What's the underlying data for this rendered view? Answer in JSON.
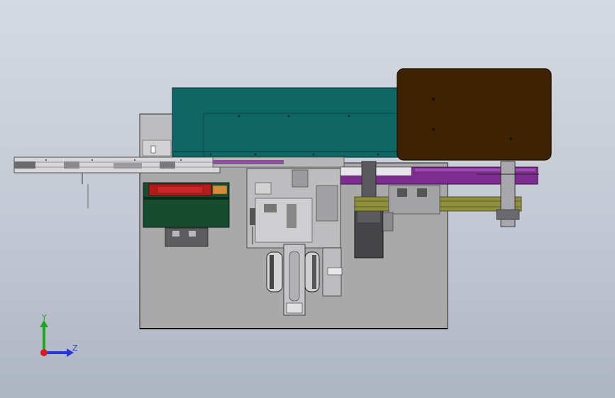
{
  "triad": {
    "y_label": "Y",
    "z_label": "Z",
    "y_color": "#1fa51f",
    "z_color": "#2436d8",
    "origin_color": "#d81f1f"
  },
  "colors": {
    "background_top": "#d5d9e2",
    "background_bottom": "#aeb5c2",
    "base_plate": "#a7a7a8",
    "teal_cover": "#0e6463",
    "brown_cover": "#3c2202",
    "purple_belt": "#7b2d8f",
    "green_box": "#164b2e",
    "red_block": "#b21818",
    "olive_belt": "#8a8a3c",
    "steel": "#c8c8cc",
    "dark_motor": "#444448"
  }
}
